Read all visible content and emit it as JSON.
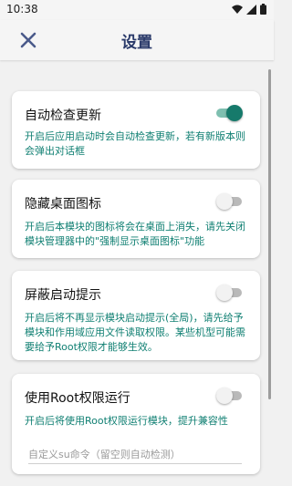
{
  "statusbar": {
    "time": "10:38"
  },
  "appbar": {
    "title": "设置"
  },
  "settings": [
    {
      "title": "自动检查更新",
      "desc": "开启后应用启动时会自动检查更新，若有新版本则会弹出对话框",
      "enabled": true
    },
    {
      "title": "隐藏桌面图标",
      "desc": "开启后本模块的图标将会在桌面上消失，请先关闭模块管理器中的\"强制显示桌面图标\"功能",
      "enabled": false
    },
    {
      "title": "屏蔽启动提示",
      "desc": "开启后将不再显示模块启动提示(全局)，请先给予模块和作用域应用文件读取权限。某些机型可能需要给予Root权限才能够生效。",
      "enabled": false
    },
    {
      "title": "使用Root权限运行",
      "desc": "开启后将使用Root权限运行模块，提升兼容性",
      "enabled": false,
      "input_placeholder": "自定义su命令（留空则自动检测）"
    }
  ],
  "colors": {
    "accent": "#167a6b",
    "desc_text": "#0f7f72",
    "title_text": "#2a3a6a"
  }
}
